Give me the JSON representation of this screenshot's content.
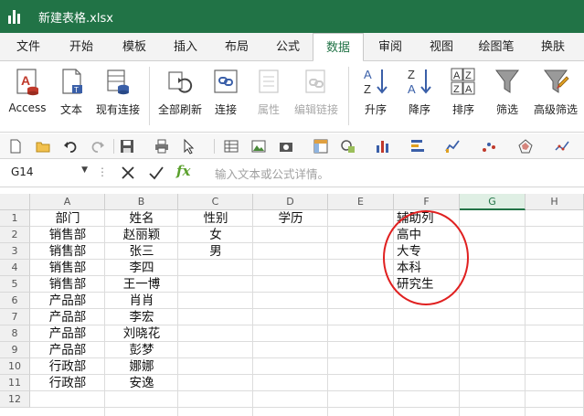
{
  "window": {
    "title": "新建表格.xlsx"
  },
  "tabs": [
    {
      "label": "文件",
      "active": false
    },
    {
      "label": "开始",
      "active": false
    },
    {
      "label": "模板",
      "active": false
    },
    {
      "label": "插入",
      "active": false
    },
    {
      "label": "布局",
      "active": false
    },
    {
      "label": "公式",
      "active": false
    },
    {
      "label": "数据",
      "active": true
    },
    {
      "label": "审阅",
      "active": false
    },
    {
      "label": "视图",
      "active": false
    },
    {
      "label": "绘图笔",
      "active": false
    },
    {
      "label": "换肤",
      "active": false
    }
  ],
  "ribbon": {
    "access": "Access",
    "text": "文本",
    "existing": "现有连接",
    "refresh_all": "全部刷新",
    "connections": "连接",
    "properties": "属性",
    "edit_links": "编辑链接",
    "sort_asc": "升序",
    "sort_desc": "降序",
    "sort": "排序",
    "filter": "筛选",
    "advanced_filter": "高级筛选"
  },
  "formula_bar": {
    "name_box": "G14",
    "fx": "fx",
    "placeholder": "输入文本或公式详情。"
  },
  "grid": {
    "columns": [
      "A",
      "B",
      "C",
      "D",
      "E",
      "F",
      "G",
      "H"
    ],
    "active_column": "G",
    "rows": [
      "1",
      "2",
      "3",
      "4",
      "5",
      "6",
      "7",
      "8",
      "9",
      "10",
      "11",
      "12"
    ],
    "data": [
      [
        "部门",
        "姓名",
        "性别",
        "学历",
        "",
        "辅助列"
      ],
      [
        "销售部",
        "赵丽颖",
        "女",
        "",
        "",
        "高中"
      ],
      [
        "销售部",
        "张三",
        "男",
        "",
        "",
        "大专"
      ],
      [
        "销售部",
        "李四",
        "",
        "",
        "",
        "本科"
      ],
      [
        "销售部",
        "王一博",
        "",
        "",
        "",
        "研究生"
      ],
      [
        "产品部",
        "肖肖",
        "",
        "",
        "",
        ""
      ],
      [
        "产品部",
        "李宏",
        "",
        "",
        "",
        ""
      ],
      [
        "产品部",
        "刘晓花",
        "",
        "",
        "",
        ""
      ],
      [
        "产品部",
        "彭梦",
        "",
        "",
        "",
        ""
      ],
      [
        "行政部",
        "娜娜",
        "",
        "",
        "",
        ""
      ],
      [
        "行政部",
        "安逸",
        "",
        "",
        "",
        ""
      ],
      [
        "",
        "",
        "",
        "",
        "",
        ""
      ]
    ]
  },
  "colors": {
    "accent": "#217346",
    "annotation": "#e02020"
  }
}
